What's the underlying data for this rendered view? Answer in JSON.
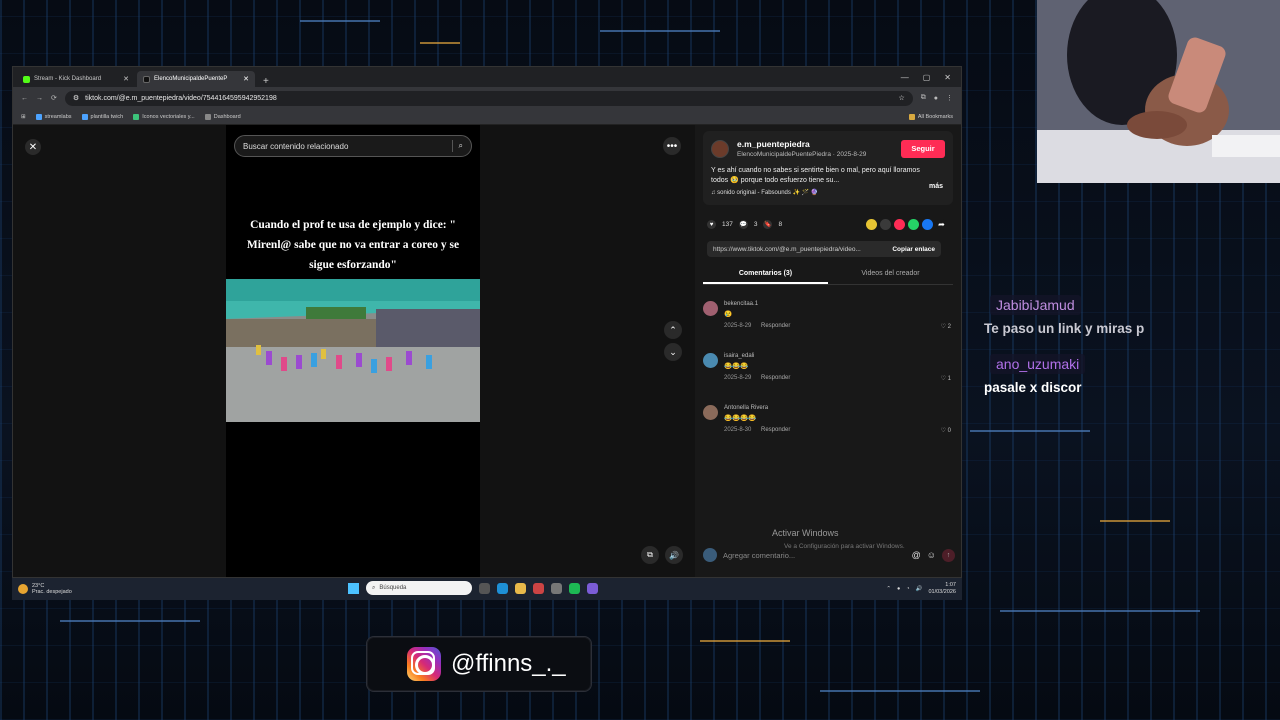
{
  "browser": {
    "tabs": [
      {
        "label": "Stream - Kick Dashboard",
        "active": false
      },
      {
        "label": "ElencoMunicipaldePuenteP",
        "active": true
      }
    ],
    "url": "tiktok.com/@e.m_puentepiedra/video/7544164595942952198",
    "bookmarks": [
      "streamlabs",
      "plantilla twich",
      "Iconos vectoriales y...",
      "Dashboard"
    ],
    "all_bookmarks": "All Bookmarks"
  },
  "video": {
    "search_placeholder": "Buscar contenido relacionado",
    "caption": "Cuando el prof te usa de ejemplo y dice: \" Mirenl@ sabe que no va entrar a coreo y se sigue esforzando\""
  },
  "author": {
    "username": "e.m_puentepiedra",
    "subtitle": "ElencoMunicipaldePuentePiedra · 2025-8-29",
    "follow_label": "Seguir",
    "description": "Y es ahí cuando no sabes si sentirte bien o mal, pero aquí lloramos todos 🥹 porque todo esfuerzo tiene su...",
    "more_label": "más",
    "music": "♫ sonido original - Fabsounds ✨ 🪄 🔮"
  },
  "stats": {
    "likes": "137",
    "comments": "3",
    "saves": "8"
  },
  "link": {
    "url": "https://www.tiktok.com/@e.m_puentepiedra/video...",
    "copy_label": "Copiar enlace"
  },
  "panel_tabs": {
    "comments": "Comentarios (3)",
    "creator_videos": "Videos del creador"
  },
  "comments": [
    {
      "user": "bekencitaa.1",
      "emoji": "😢",
      "date": "2025-8-29",
      "reply": "Responder",
      "likes": "2"
    },
    {
      "user": "isaira_edali",
      "emoji": "😂😂😂",
      "date": "2025-8-29",
      "reply": "Responder",
      "likes": "1"
    },
    {
      "user": "Antonella Rivera",
      "emoji": "😂😂😂😂",
      "date": "2025-8-30",
      "reply": "Responder",
      "likes": "0"
    }
  ],
  "comment_input": {
    "placeholder": "Agregar comentario..."
  },
  "windows_watermark": {
    "line1": "Activar Windows",
    "line2": "Ve a Configuración para activar Windows."
  },
  "taskbar": {
    "temperature": "23°C",
    "weather": "Prac. despejado",
    "search_placeholder": "Búsqueda",
    "time": "1:07",
    "date": "01/03/2026"
  },
  "chat": [
    {
      "name": "JabibiJamud",
      "message": "Te paso un link y miras p",
      "name_color": "#c08ee0"
    },
    {
      "name": "ano_uzumaki",
      "message": "pasale x discor",
      "name_color": "#b070e8"
    }
  ],
  "social": {
    "handle": "@ffinns_._"
  },
  "colors": {
    "tiktok_red": "#fe2c55",
    "kick_green": "#53fc18"
  }
}
